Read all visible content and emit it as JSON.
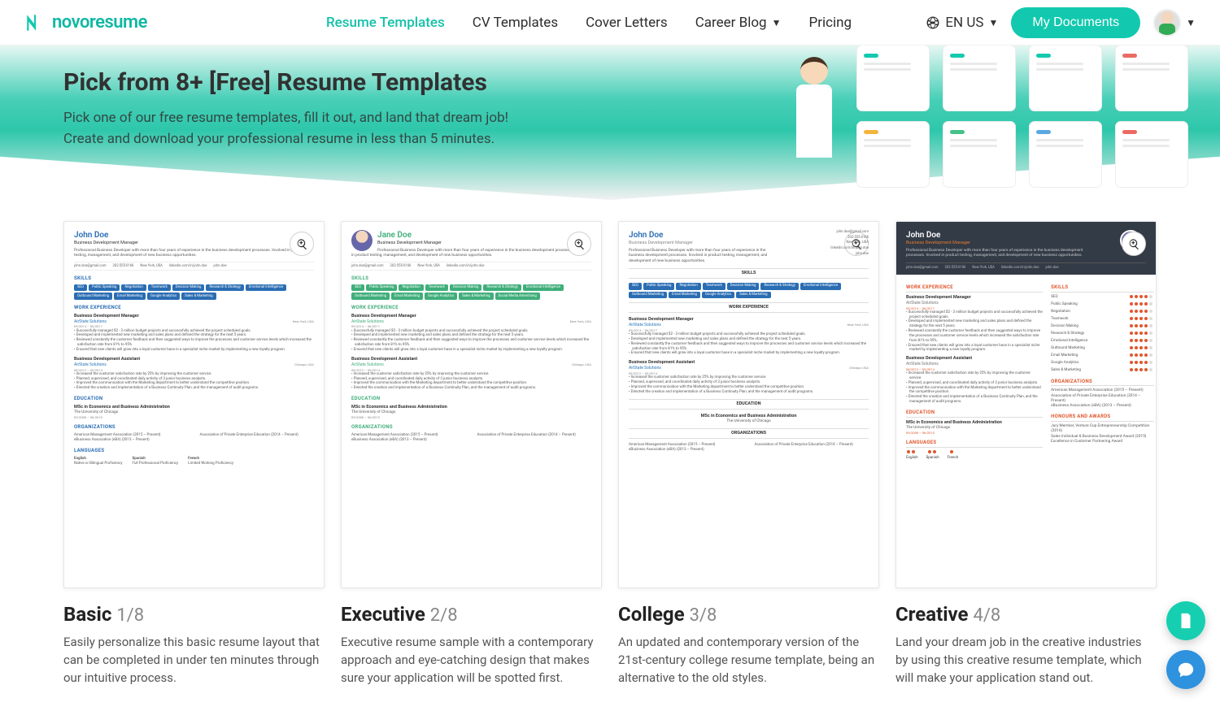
{
  "brand": "novoresume",
  "nav": {
    "resume_templates": "Resume Templates",
    "cv_templates": "CV Templates",
    "cover_letters": "Cover Letters",
    "career_blog": "Career Blog",
    "pricing": "Pricing",
    "lang": "EN US",
    "my_docs": "My Documents"
  },
  "hero": {
    "title": "Pick from 8+ [Free] Resume Templates",
    "sub1": "Pick one of our free resume templates, fill it out, and land that dream job!",
    "sub2": "Create and download your professional resume in less than 5 minutes."
  },
  "sample": {
    "name_john": "John Doe",
    "name_jane": "Jane Doe",
    "role": "Business Development Manager",
    "summary": "Professional Business Developer with more than four years of experience in the business development processes. Involved in product testing, management, and development of new business opportunities.",
    "contacts": {
      "email": "john.doe@gmail.com",
      "phone": "202-555-0166",
      "loc": "New York, USA",
      "linkedin": "linkedin.com/in/john.doe",
      "skype": "john.doe"
    },
    "skills_hd": "SKILLS",
    "skills": [
      "SEO",
      "Public Speaking",
      "Negotiation",
      "Teamwork",
      "Decision Making",
      "Research & Strategy",
      "Emotional Intelligence",
      "Outbound Marketing",
      "Email Marketing",
      "Google Analytics",
      "Sales & Marketing",
      "Social Media Advertising"
    ],
    "work_hd": "WORK EXPERIENCE",
    "job1": {
      "title": "Business Development Manager",
      "company": "AirState Solutions",
      "dates": "09/2014 – 06/2017",
      "loc": "New York, USA",
      "bullets": [
        "Successfully managed $2 - 3 million budget projects and successfully achieved the project scheduled goals.",
        "Developed and implemented new marketing and sales plans and defined the strategy for the next 5 years.",
        "Reviewed constantly the customer feedback and then suggested ways to improve the processes and customer service levels which increased the satisfaction rate from 81% to 95%.",
        "Ensured that new clients will grow into a loyal customer base in a specialist niche market by implementing a new loyalty program."
      ]
    },
    "job2": {
      "title": "Business Development Assistant",
      "company": "AirState Solutions",
      "dates": "08/2012 – 09/2014",
      "loc": "Chicago, USA",
      "bullets": [
        "Increased the customer satisfaction rate by 25% by improving the customer service.",
        "Planned, supervised, and coordinated daily activity of 3 junior business analysts.",
        "Improved the communication with the Marketing department to better understand the competitive position.",
        "Directed the creation and implementation of a Business Continuity Plan, and the management of audit programs."
      ]
    },
    "edu_hd": "EDUCATION",
    "edu": {
      "deg": "MSc in Economics and Business Administration",
      "school": "The University of Chicago",
      "dates": "09/2008 – 06/2010"
    },
    "org_hd": "ORGANIZATIONS",
    "orgs": [
      "American Management Association (2015 – Present)",
      "Association of Private Enterprise Education (2014 – Present)",
      "eBusiness Association (eBA) (2013 – Present)"
    ],
    "lang_hd": "LANGUAGES",
    "langs": [
      {
        "l": "English",
        "p": "Native or Bilingual Proficiency"
      },
      {
        "l": "Spanish",
        "p": "Full Professional Proficiency"
      },
      {
        "l": "French",
        "p": "Limited Working Proficiency"
      }
    ],
    "honours_hd": "HONOURS AND AWARDS",
    "honours": [
      "Jury Member, Venture Cup Entrepreneurship Competition (2016)",
      "Sales Individual & Business Development Award (2015)",
      "Excellence in Customer Partnering Award"
    ]
  },
  "cards": {
    "basic": {
      "title": "Basic",
      "idx": "1/8",
      "desc": "Easily personalize this basic resume layout that can be completed in under ten minutes through our intuitive process."
    },
    "executive": {
      "title": "Executive",
      "idx": "2/8",
      "desc": "Executive resume sample with a contemporary approach and eye-catching design that makes sure your application will be spotted first."
    },
    "college": {
      "title": "College",
      "idx": "3/8",
      "desc": "An updated and contemporary version of the 21st-century college resume template, being an alternative to the old styles."
    },
    "creative": {
      "title": "Creative",
      "idx": "4/8",
      "desc": "Land your dream job in the creative industries by using this creative resume template, which will make your application stand out."
    }
  },
  "dec_colors": [
    "#14c9ae",
    "#f3b53a",
    "#44c28a",
    "#5aa8e0",
    "#ea6b63"
  ]
}
